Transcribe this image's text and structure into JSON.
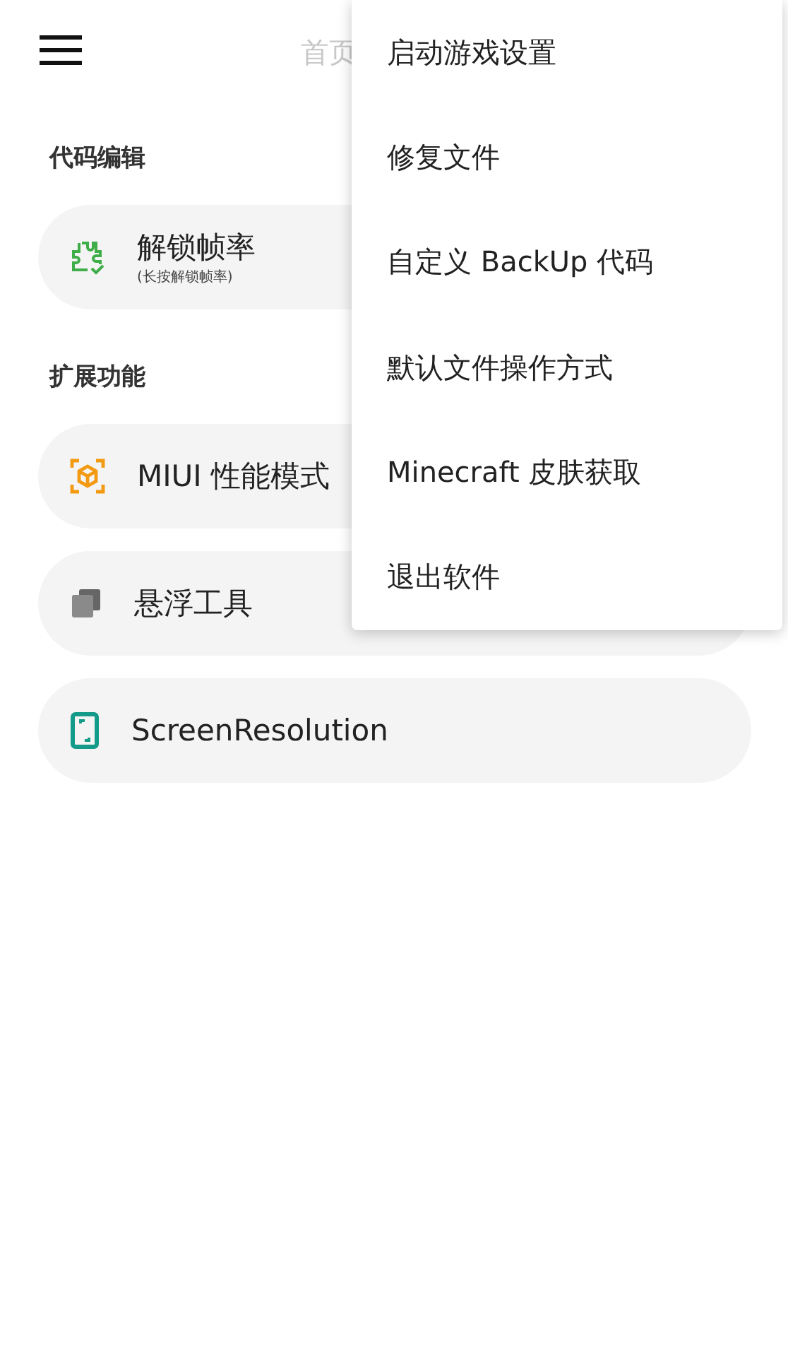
{
  "app_bar": {
    "title": "首页"
  },
  "sections": [
    {
      "title": "代码编辑",
      "items": [
        {
          "kind": "puzzle",
          "label": "解锁帧率",
          "hint": "(长按解锁帧率)"
        }
      ]
    },
    {
      "title": "扩展功能",
      "items": [
        {
          "kind": "cube",
          "label": "MIUI 性能模式"
        },
        {
          "kind": "layers",
          "label": "悬浮工具"
        },
        {
          "kind": "phone",
          "label": "ScreenResolution"
        }
      ]
    }
  ],
  "menu": [
    "启动游戏设置",
    "修复文件",
    "自定义 BackUp 代码",
    "默认文件操作方式",
    "Minecraft 皮肤获取",
    "退出软件"
  ]
}
